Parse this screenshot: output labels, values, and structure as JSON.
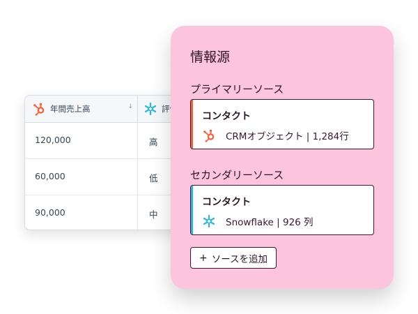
{
  "table": {
    "columns": [
      {
        "label": "年間売上高",
        "icon": "hubspot-icon",
        "sort": "↓"
      },
      {
        "label": "評価",
        "icon": "snowflake-icon"
      }
    ],
    "rows": [
      {
        "revenue": "120,000",
        "rating": "高"
      },
      {
        "revenue": "60,000",
        "rating": "低"
      },
      {
        "revenue": "90,000",
        "rating": "中"
      }
    ]
  },
  "panel": {
    "title": "情報源",
    "primary": {
      "label": "プライマリーソース",
      "card_title": "コンタクト",
      "detail": "CRMオブジェクト | 1,284行",
      "icon": "hubspot-icon",
      "accent": "#ff5c35"
    },
    "secondary": {
      "label": "セカンダリーソース",
      "card_title": "コンタクト",
      "detail": "Snowflake | 926 列",
      "icon": "snowflake-icon",
      "accent": "#29b5e8"
    },
    "add_button": {
      "plus": "+",
      "label": "ソースを追加"
    }
  },
  "colors": {
    "panel_bg": "#fcc4dd",
    "hubspot": "#ff5c35",
    "snowflake": "#29b5e8"
  }
}
